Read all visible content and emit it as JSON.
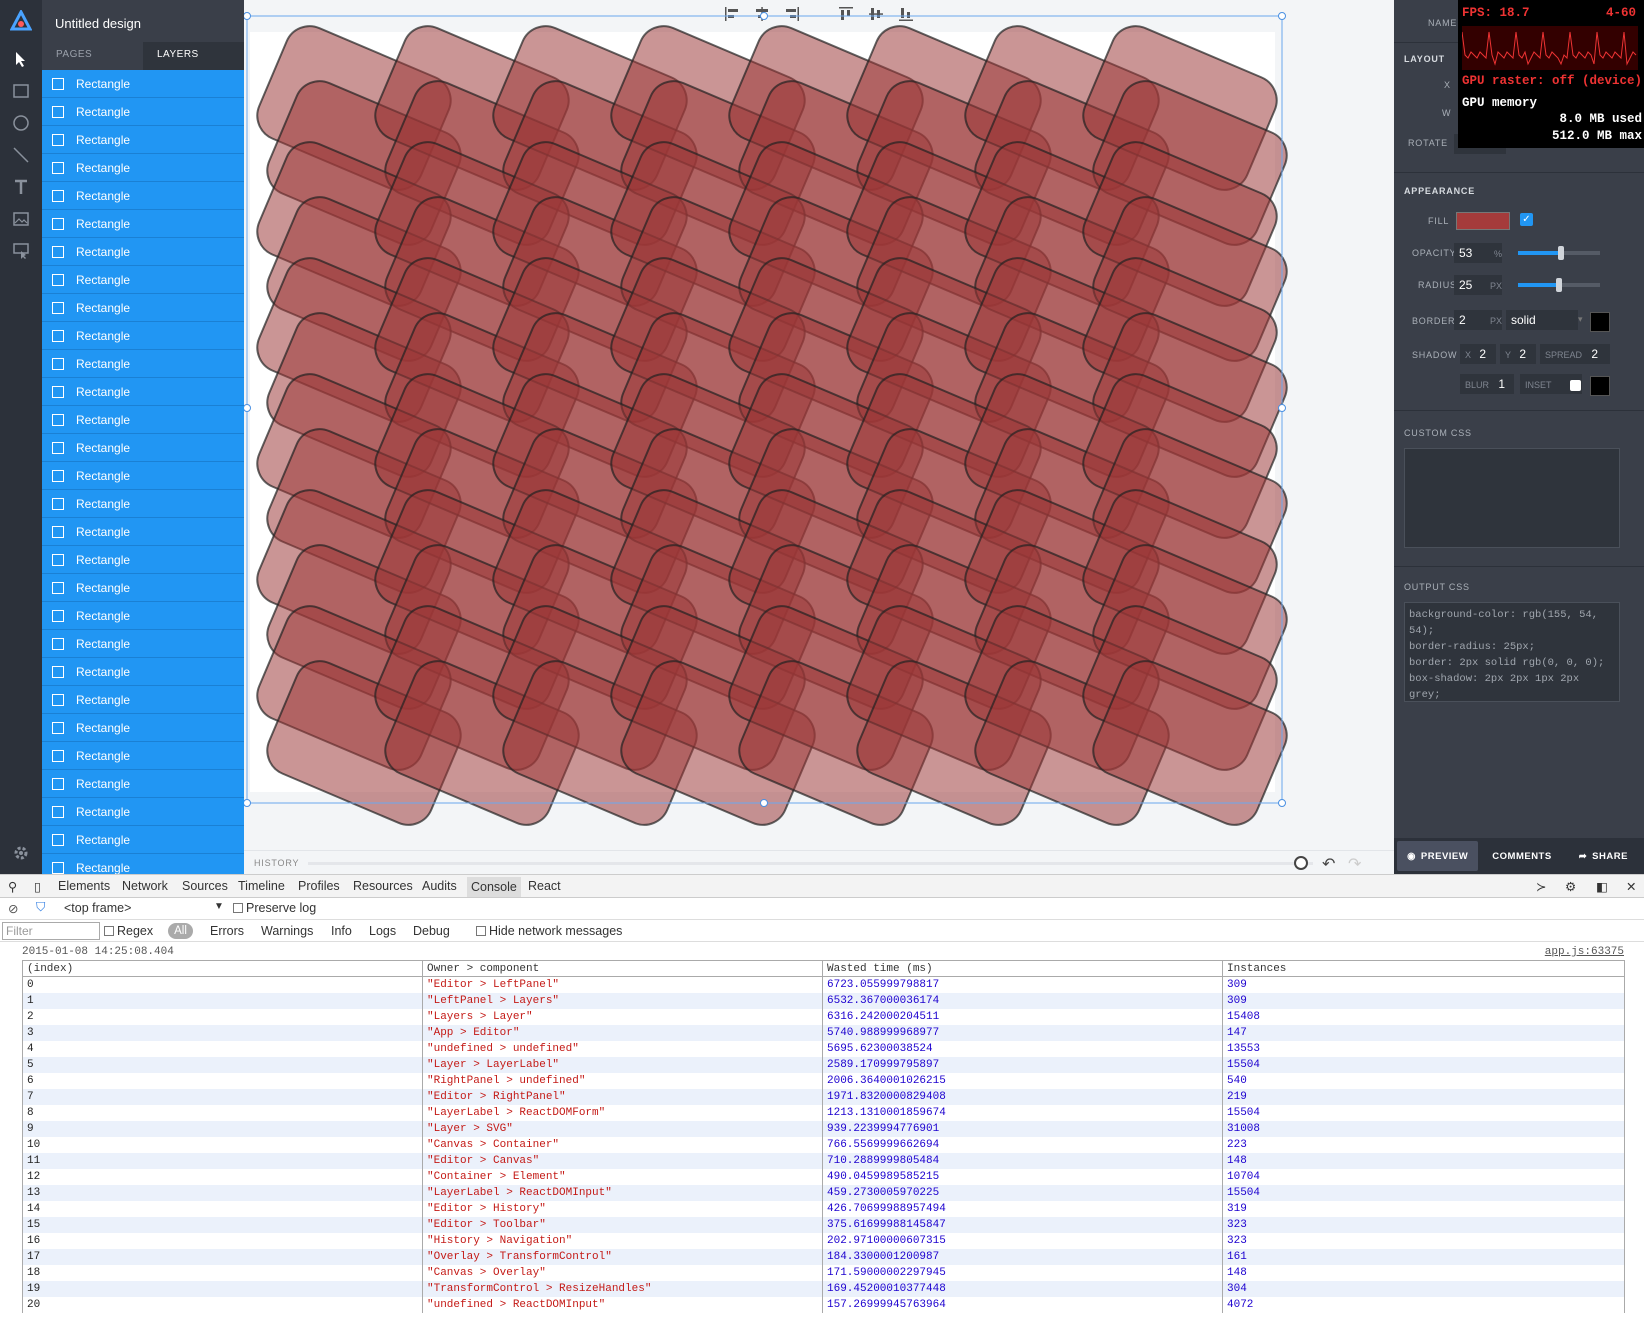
{
  "app": {
    "document_title": "Untitled design",
    "tabs": [
      "PAGES",
      "LAYERS"
    ],
    "active_tab": "LAYERS",
    "layers": [
      "Rectangle",
      "Rectangle",
      "Rectangle",
      "Rectangle",
      "Rectangle",
      "Rectangle",
      "Rectangle",
      "Rectangle",
      "Rectangle",
      "Rectangle",
      "Rectangle",
      "Rectangle",
      "Rectangle",
      "Rectangle",
      "Rectangle",
      "Rectangle",
      "Rectangle",
      "Rectangle",
      "Rectangle",
      "Rectangle",
      "Rectangle",
      "Rectangle",
      "Rectangle",
      "Rectangle",
      "Rectangle",
      "Rectangle",
      "Rectangle",
      "Rectangle",
      "Rectangle",
      "Rectangle"
    ],
    "tools": [
      "logo-icon",
      "pointer-icon",
      "rectangle-icon",
      "circle-icon",
      "line-icon",
      "text-icon",
      "image-icon",
      "component-icon",
      "settings-icon"
    ],
    "layer_color": "#2196f3"
  },
  "canvas": {
    "toolbar_icons": [
      "align-left-icon",
      "align-center-icon",
      "align-right-icon",
      "align-top-icon",
      "align-middle-icon",
      "align-bottom-icon"
    ],
    "history_label": "HISTORY",
    "shape_fill": "#9b3636",
    "shape_stroke": "#000000"
  },
  "inspector": {
    "name_label": "NAME",
    "layout_label": "LAYOUT",
    "x_label": "X",
    "w_label": "W",
    "rotate_label": "ROTATE",
    "appearance_label": "APPEARANCE",
    "fill_label": "FILL",
    "fill_color": "#a53b3b",
    "fill_checked": true,
    "opacity_label": "OPACITY",
    "opacity_value": "53",
    "opacity_unit": "%",
    "opacity_fraction": 0.53,
    "radius_label": "RADIUS",
    "radius_value": "25",
    "radius_unit": "PX",
    "radius_fraction": 0.5,
    "border_label": "BORDER",
    "border_value": "2",
    "border_unit": "PX",
    "border_style": "solid",
    "shadow_label": "SHADOW",
    "shadow_x_label": "X",
    "shadow_x": "2",
    "shadow_y_label": "Y",
    "shadow_y": "2",
    "spread_label": "SPREAD",
    "spread_value": "2",
    "blur_label": "BLUR",
    "blur_value": "1",
    "inset_label": "INSET",
    "custom_css_label": "CUSTOM CSS",
    "output_css_label": "OUTPUT CSS",
    "output_css_lines": [
      "background-color: rgb(155, 54,",
      "54);",
      "border-radius: 25px;",
      "border: 2px solid rgb(0, 0, 0);",
      "box-shadow: 2px 2px 1px 2px",
      "grey;"
    ],
    "footer": {
      "preview": "PREVIEW",
      "comments": "COMMENTS",
      "share": "SHARE"
    }
  },
  "fps_meter": {
    "fps_text": "FPS: 18.7",
    "range_text": "4-60",
    "gpu_raster_text": "GPU raster: off (device)",
    "gpu_memory_label": "GPU memory",
    "used_text": "8.0 MB used",
    "max_text": "512.0 MB max"
  },
  "devtools": {
    "tabs": [
      "Elements",
      "Network",
      "Sources",
      "Timeline",
      "Profiles",
      "Resources",
      "Audits",
      "Console",
      "React"
    ],
    "active_tab": "Console",
    "frame_select": "<top frame>",
    "preserve_log": "Preserve log",
    "filter_placeholder": "Filter",
    "regex": "Regex",
    "levels": [
      "All",
      "Errors",
      "Warnings",
      "Info",
      "Logs",
      "Debug"
    ],
    "hide_network": "Hide network messages",
    "timestamp": "2015-01-08 14:25:08.404",
    "source_link": "app.js:63375",
    "table_headers": [
      "(index)",
      "Owner > component",
      "Wasted time (ms)",
      "Instances"
    ],
    "rows": [
      [
        "0",
        "\"Editor > LeftPanel\"",
        "6723.055999798817",
        "309"
      ],
      [
        "1",
        "\"LeftPanel > Layers\"",
        "6532.367000036174",
        "309"
      ],
      [
        "2",
        "\"Layers > Layer\"",
        "6316.242000204511",
        "15408"
      ],
      [
        "3",
        "\"App > Editor\"",
        "5740.988999968977",
        "147"
      ],
      [
        "4",
        "\"undefined > undefined\"",
        "5695.62300038524",
        "13553"
      ],
      [
        "5",
        "\"Layer > LayerLabel\"",
        "2589.170999795897",
        "15504"
      ],
      [
        "6",
        "\"RightPanel > undefined\"",
        "2006.3640001026215",
        "540"
      ],
      [
        "7",
        "\"Editor > RightPanel\"",
        "1971.8320000829408",
        "219"
      ],
      [
        "8",
        "\"LayerLabel > ReactDOMForm\"",
        "1213.1310001859674",
        "15504"
      ],
      [
        "9",
        "\"Layer > SVG\"",
        "939.2239994776901",
        "31008"
      ],
      [
        "10",
        "\"Canvas > Container\"",
        "766.5569999662694",
        "223"
      ],
      [
        "11",
        "\"Editor > Canvas\"",
        "710.2889999805484",
        "148"
      ],
      [
        "12",
        "\"Container > Element\"",
        "490.0459989585215",
        "10704"
      ],
      [
        "13",
        "\"LayerLabel > ReactDOMInput\"",
        "459.2730005970225",
        "15504"
      ],
      [
        "14",
        "\"Editor > History\"",
        "426.70699988957494",
        "319"
      ],
      [
        "15",
        "\"Editor > Toolbar\"",
        "375.61699988145847",
        "323"
      ],
      [
        "16",
        "\"History > Navigation\"",
        "202.97100000607315",
        "323"
      ],
      [
        "17",
        "\"Overlay > TransformControl\"",
        "184.3300001200987",
        "161"
      ],
      [
        "18",
        "\"Canvas > Overlay\"",
        "171.59000002297945",
        "148"
      ],
      [
        "19",
        "\"TransformControl > ResizeHandles\"",
        "169.45200010377448",
        "304"
      ],
      [
        "20",
        "\"undefined > ReactDOMInput\"",
        "157.26999945763964",
        "4072"
      ]
    ]
  }
}
